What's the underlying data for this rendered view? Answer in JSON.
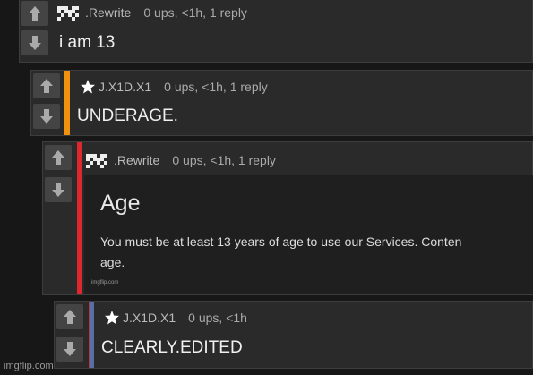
{
  "comments": [
    {
      "user": ".Rewrite",
      "meta": "0 ups, <1h, 1 reply",
      "text": "i am 13",
      "icon": "pixel-avatar-icon",
      "accent": ""
    },
    {
      "user": "J.X1D.X1",
      "meta": "0 ups, <1h, 1 reply",
      "text": "UNDERAGE.",
      "icon": "star-icon",
      "accent": "#f0920f"
    },
    {
      "user": ".Rewrite",
      "meta": "0 ups, <1h, 1 reply",
      "text": "",
      "icon": "pixel-avatar-icon",
      "accent": "#e0262f"
    },
    {
      "user": "J.X1D.X1",
      "meta": "0 ups, <1h",
      "text": "CLEARLY.EDITED",
      "icon": "star-icon",
      "accent": "#5a6fa8"
    }
  ],
  "embed": {
    "title": "Age",
    "text_line1": "You must be at least 13 years of age to use our Services. Conten",
    "text_line2": "age.",
    "watermark": "imgflip.com"
  },
  "watermark": "imgflip.com",
  "colors": {
    "background": "#171717",
    "panel": "#2a2a2a",
    "vote_button": "#444444"
  }
}
